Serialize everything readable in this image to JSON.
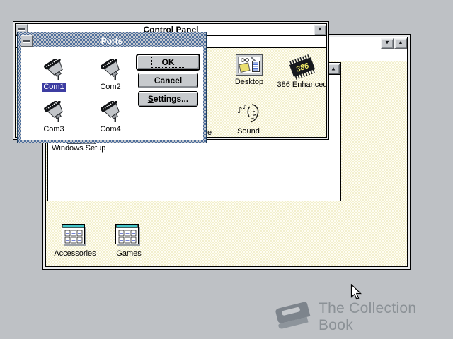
{
  "watermark": {
    "text": "The Collection Book"
  },
  "program_manager": {
    "minimize_glyph": "▼",
    "maximize_glyph": "▲",
    "group_window": {
      "maximize_glyph": "▲",
      "items": [
        {
          "label": "Windows Setup"
        }
      ]
    },
    "groups": [
      {
        "label": "Accessories"
      },
      {
        "label": "Games"
      }
    ]
  },
  "control_panel": {
    "title": "Control Panel",
    "minimize_glyph": "▼",
    "chip_label": "386",
    "icons": [
      {
        "label": "Desktop"
      },
      {
        "label": "386 Enhanced"
      },
      {
        "label": "e",
        "partial": true
      },
      {
        "label": "Sound"
      }
    ]
  },
  "ports_dialog": {
    "title": "Ports",
    "selected_port": "Com1",
    "ports": [
      {
        "label": "Com1",
        "selected": true
      },
      {
        "label": "Com2",
        "selected": false
      },
      {
        "label": "Com3",
        "selected": false
      },
      {
        "label": "Com4",
        "selected": false
      }
    ],
    "buttons": {
      "ok": "OK",
      "cancel": "Cancel",
      "settings_initial": "S",
      "settings_rest": "ettings..."
    }
  },
  "colors": {
    "desktop_bg": "#bec1c5",
    "titlebar_dither_blue": "#4e6f9d",
    "selection_blue": "#3d3da2",
    "content_tint": "#fefdf2",
    "watermark_gray": "#8b9196"
  }
}
